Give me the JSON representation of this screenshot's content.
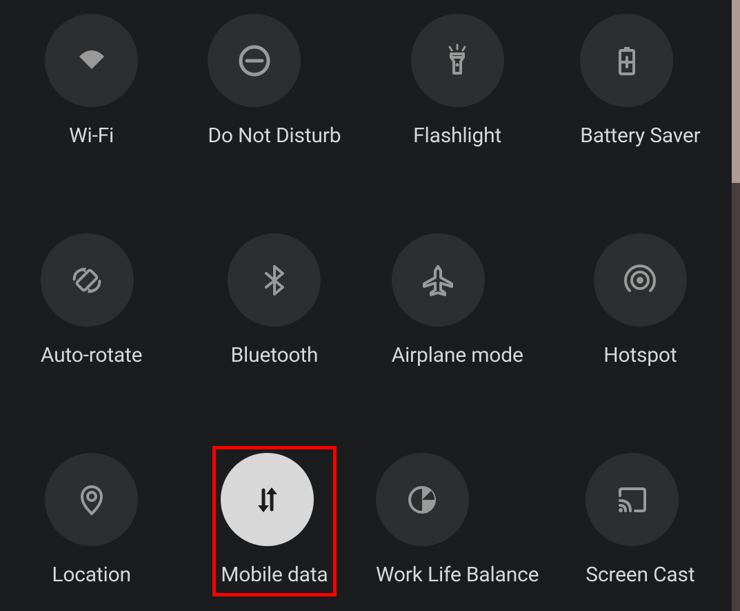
{
  "tiles": [
    {
      "id": "wifi",
      "label": "Wi-Fi",
      "icon": "wifi-icon",
      "active": false,
      "highlighted": false
    },
    {
      "id": "dnd",
      "label": "Do Not Disturb",
      "icon": "dnd-icon",
      "active": false,
      "highlighted": false
    },
    {
      "id": "flash",
      "label": "Flashlight",
      "icon": "flashlight-icon",
      "active": false,
      "highlighted": false
    },
    {
      "id": "battery",
      "label": "Battery Saver",
      "icon": "battery-icon",
      "active": false,
      "highlighted": false
    },
    {
      "id": "rotate",
      "label": "Auto-rotate",
      "icon": "rotate-icon",
      "active": false,
      "highlighted": false
    },
    {
      "id": "bt",
      "label": "Bluetooth",
      "icon": "bluetooth-icon",
      "active": false,
      "highlighted": false
    },
    {
      "id": "plane",
      "label": "Airplane mode",
      "icon": "airplane-icon",
      "active": false,
      "highlighted": false
    },
    {
      "id": "hotspot",
      "label": "Hotspot",
      "icon": "hotspot-icon",
      "active": false,
      "highlighted": false
    },
    {
      "id": "location",
      "label": "Location",
      "icon": "location-icon",
      "active": false,
      "highlighted": false
    },
    {
      "id": "mobiledata",
      "label": "Mobile data",
      "icon": "mobiledata-icon",
      "active": true,
      "highlighted": true
    },
    {
      "id": "worklife",
      "label": "Work Life Balance",
      "icon": "worklife-icon",
      "active": false,
      "highlighted": false
    },
    {
      "id": "cast",
      "label": "Screen Cast",
      "icon": "cast-icon",
      "active": false,
      "highlighted": false
    }
  ],
  "colors": {
    "background": "#1a1c1d",
    "tileInactive": "#2c2e2f",
    "tileActive": "#d8d8d8",
    "iconInactive": "#9a9a9a",
    "iconActive": "#1a1c1d",
    "text": "#d8d8d8",
    "highlightBorder": "#ff0000"
  }
}
